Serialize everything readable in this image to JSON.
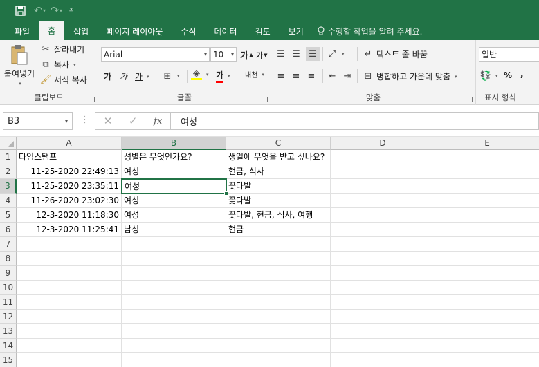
{
  "quick_access": {
    "save_icon": "save-icon",
    "undo_icon": "undo-icon",
    "redo_icon": "redo-icon",
    "customize_icon": "customize-icon"
  },
  "tabs": [
    "파일",
    "홈",
    "삽입",
    "페이지 레이아웃",
    "수식",
    "데이터",
    "검토",
    "보기"
  ],
  "active_tab": "홈",
  "tell_me": "수행할 작업을 알려 주세요.",
  "ribbon": {
    "clipboard": {
      "label": "클립보드",
      "paste": "붙여넣기",
      "cut": "잘라내기",
      "copy": "복사",
      "format_painter": "서식 복사"
    },
    "font": {
      "label": "글꼴",
      "name": "Arial",
      "size": "10",
      "grow": "가",
      "shrink": "가",
      "bold": "가",
      "italic": "가",
      "underline": "가",
      "font_color": "가",
      "phonetic": "내천"
    },
    "alignment": {
      "label": "맞춤",
      "wrap_text": "텍스트 줄 바꿈",
      "merge_center": "병합하고 가운데 맞춤"
    },
    "number": {
      "label": "표시 형식",
      "format": "일반",
      "percent": "%",
      "comma": ","
    }
  },
  "name_box": "B3",
  "formula_bar": {
    "fx": "fx",
    "content": "여성"
  },
  "selected_cell": "B3",
  "columns": [
    "A",
    "B",
    "C",
    "D",
    "E"
  ],
  "rows": [
    "1",
    "2",
    "3",
    "4",
    "5",
    "6",
    "7",
    "8",
    "9",
    "10",
    "11",
    "12",
    "13",
    "14",
    "15"
  ],
  "headers": [
    "타임스탬프",
    "성별은 무엇인가요?",
    "생일에 무엇을 받고 싶나요?"
  ],
  "data_rows": [
    [
      "11-25-2020 22:49:13",
      "여성",
      "현금, 식사"
    ],
    [
      "11-25-2020 23:35:11",
      "여성",
      "꽃다발"
    ],
    [
      "11-26-2020 23:02:30",
      "여성",
      "꽃다발"
    ],
    [
      "12-3-2020 11:18:30",
      "여성",
      "꽃다발, 현금, 식사, 여행"
    ],
    [
      "12-3-2020 11:25:41",
      "남성",
      "현금"
    ]
  ],
  "colors": {
    "accent": "#217346",
    "ribbon_bg": "#f3f3f3"
  }
}
